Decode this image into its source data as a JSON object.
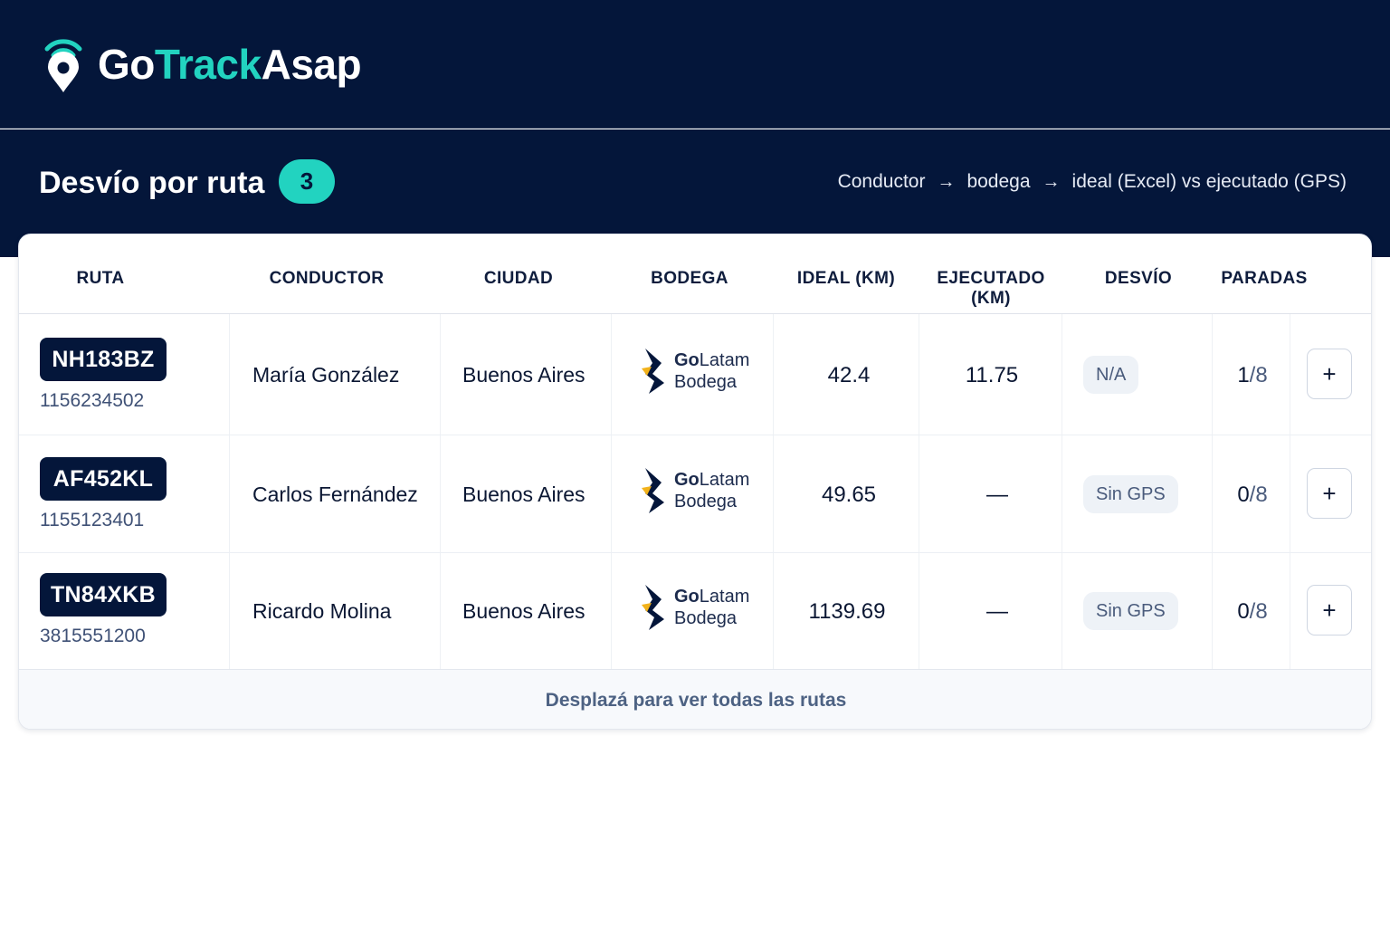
{
  "app": {
    "logo_primary": "Go",
    "logo_accent": "Track",
    "logo_suffix": "Asap"
  },
  "colors": {
    "navy": "#04163a",
    "accent": "#22d3c0",
    "muted": "#4a5b7c"
  },
  "header": {
    "title": "Desvío por ruta",
    "count": "3",
    "flow": [
      "Conductor",
      "bodega",
      "ideal (Excel) vs ejecutado (GPS)"
    ],
    "flow_arrow": "→"
  },
  "table": {
    "columns": [
      "RUTA",
      "CONDUCTOR",
      "CIUDAD",
      "BODEGA",
      "IDEAL (KM)",
      "EJECUTADO (KM)",
      "DESVÍO",
      "PARADAS"
    ],
    "rows": [
      {
        "plate": "NH183BZ",
        "phone": "1156234502",
        "driver": "María González",
        "city": "Buenos Aires",
        "warehouse_brand": "Go",
        "warehouse_brand2": "Latam",
        "warehouse_label": "Bodega",
        "ideal_km": "42.4",
        "executed_km": "11.75",
        "deviation": "N/A",
        "stops_done": "1",
        "stops_total": "/8",
        "add_label": "+"
      },
      {
        "plate": "AF452KL",
        "phone": "1155123401",
        "driver": "Carlos Fernández",
        "city": "Buenos Aires",
        "warehouse_brand": "Go",
        "warehouse_brand2": "Latam",
        "warehouse_label": "Bodega",
        "ideal_km": "49.65",
        "executed_km": "—",
        "deviation": "Sin GPS",
        "stops_done": "0",
        "stops_total": "/8",
        "add_label": "+"
      },
      {
        "plate": "TN84XKB",
        "phone": "3815551200",
        "driver": "Ricardo Molina",
        "city": "Buenos Aires",
        "warehouse_brand": "Go",
        "warehouse_brand2": "Latam",
        "warehouse_label": "Bodega",
        "ideal_km": "1139.69",
        "executed_km": "—",
        "deviation": "Sin GPS",
        "stops_done": "0",
        "stops_total": "/8",
        "add_label": "+"
      }
    ],
    "footer_hint": "Desplazá para ver todas las rutas"
  }
}
